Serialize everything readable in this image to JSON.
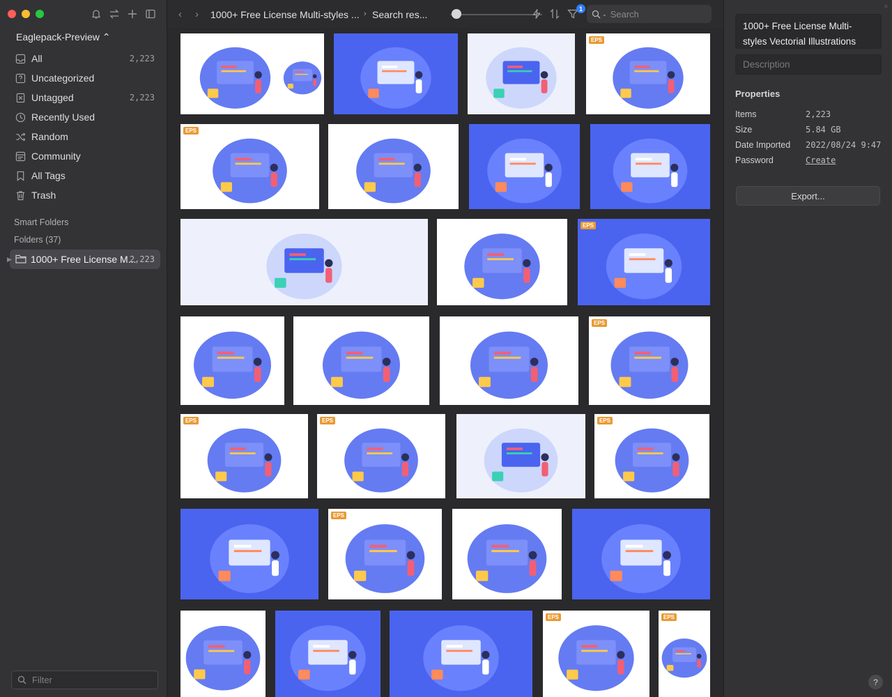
{
  "sidebar": {
    "library_name": "Eaglepack-Preview ⌃",
    "items": [
      {
        "label": "All",
        "count": "2,223",
        "icon": "inbox-icon"
      },
      {
        "label": "Uncategorized",
        "count": "",
        "icon": "uncategorized-icon"
      },
      {
        "label": "Untagged",
        "count": "2,223",
        "icon": "untagged-icon"
      },
      {
        "label": "Recently Used",
        "count": "",
        "icon": "clock-icon"
      },
      {
        "label": "Random",
        "count": "",
        "icon": "shuffle-icon"
      },
      {
        "label": "Community",
        "count": "",
        "icon": "community-icon"
      },
      {
        "label": "All Tags",
        "count": "",
        "icon": "tag-icon"
      },
      {
        "label": "Trash",
        "count": "",
        "icon": "trash-icon"
      }
    ],
    "smart_folders_label": "Smart Folders",
    "folders_label": "Folders (37)",
    "folder": {
      "label": "1000+ Free License M...",
      "count": "2,223"
    },
    "filter_placeholder": "Filter"
  },
  "toolbar": {
    "crumb1": "1000+ Free License Multi-styles ...",
    "crumb2": "Search res...",
    "filter_badge": "1",
    "search_placeholder": "Search",
    "thumbnail_size": 0.1
  },
  "grid": {
    "badge_label": "EPS"
  },
  "inspector": {
    "title": "1000+ Free License Multi-styles Vectorial Illustrations",
    "description_placeholder": "Description",
    "properties_heading": "Properties",
    "properties": [
      {
        "label": "Items",
        "value": "2,223"
      },
      {
        "label": "Size",
        "value": "5.84 GB"
      },
      {
        "label": "Date Imported",
        "value": "2022/08/24 9:47"
      },
      {
        "label": "Password",
        "value": "Create"
      }
    ],
    "export_label": "Export...",
    "help_label": "?"
  },
  "colors": {
    "accent": "#2f7df6",
    "eps_badge": "#e99a34",
    "illustration_blue": "#4a64f0"
  }
}
